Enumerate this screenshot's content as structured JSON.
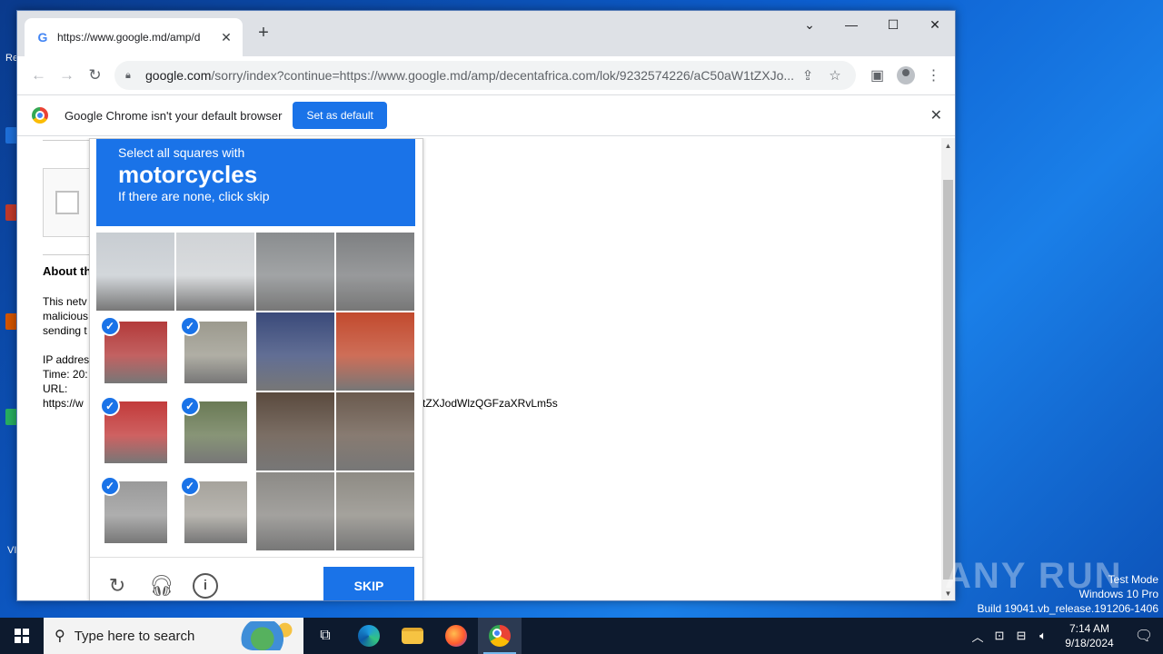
{
  "desktop": {
    "left_labels": [
      "Re",
      "VI"
    ]
  },
  "browser": {
    "tab_title": "https://www.google.md/amp/d",
    "url_host": "google.com",
    "url_path": "/sorry/index?continue=https://www.google.md/amp/decentafrica.com/lok/9232574226/aC50aW1tZXJo...",
    "infobar_text": "Google Chrome isn't your default browser",
    "set_default_label": "Set as default"
  },
  "page": {
    "heading": "About th",
    "para_lines": [
      "This netv",
      "malicious",
      "sending t"
    ],
    "ip_line": "IP addres",
    "time_line": "Time: 20:",
    "url_label": "URL:",
    "url_start": "https://w",
    "url_tail": "tZXJodWlzQGFzaXRvLm5s"
  },
  "captcha": {
    "instruction_top": "Select all squares with",
    "target": "motorcycles",
    "instruction_bottom": "If there are none, click skip",
    "skip_label": "SKIP",
    "selected": [
      4,
      5,
      8,
      9,
      12,
      13
    ],
    "check_glyph": "✓"
  },
  "taskbar": {
    "search_placeholder": "Type here to search",
    "time": "7:14 AM",
    "date": "9/18/2024"
  },
  "watermark": {
    "line1": "Test Mode",
    "line2": "Windows 10 Pro",
    "line3": "Build 19041.vb_release.191206-1406",
    "brand": "ANY RUN"
  },
  "colors": {
    "accent": "#1a73e8",
    "taskbar": "#0d1a2e"
  }
}
